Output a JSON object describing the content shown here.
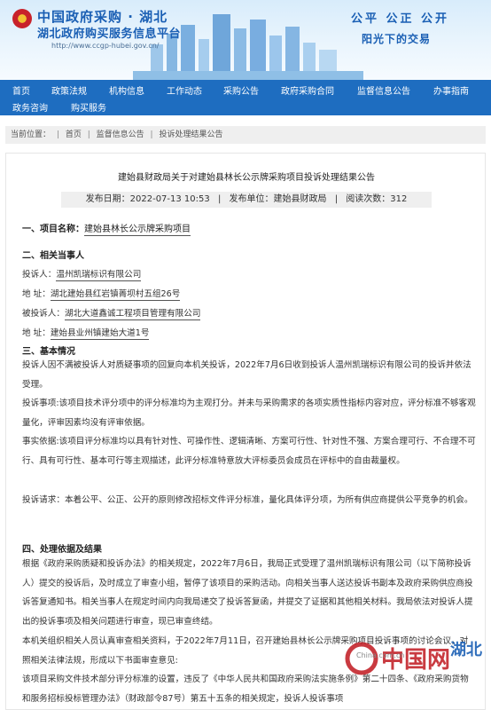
{
  "header": {
    "title": "中国政府采购 · 湖北",
    "subtitle": "湖北政府购买服务信息平台",
    "url": "http://www.ccgp-hubei.gov.cn/",
    "slogan_1": "公平  公正  公开",
    "slogan_2": "阳光下的交易"
  },
  "nav": {
    "items": [
      {
        "label": "首页"
      },
      {
        "label": "政策法规"
      },
      {
        "label": "机构信息"
      },
      {
        "label": "工作动态"
      },
      {
        "label": "采购公告"
      },
      {
        "label": "政府采购合同"
      },
      {
        "label": "监督信息公告"
      },
      {
        "label": "办事指南"
      },
      {
        "label": "政务咨询"
      },
      {
        "label": "购买服务"
      }
    ]
  },
  "breadcrumb": {
    "prefix": "当前位置：",
    "items": [
      "首页",
      "监督信息公告",
      "投诉处理结果公告"
    ]
  },
  "article": {
    "title": "建始县财政局关于对建始县林长公示牌采购项目投诉处理结果公告",
    "publish_date": "发布日期：2022-07-13 10:53",
    "publisher": "发布单位：建始县财政局",
    "views": "阅读次数：312",
    "s1_heading": "一、项目名称：",
    "s1_value": "建始县林长公示牌采购项目",
    "s2_heading": "二、相关当事人",
    "complainant_label": "投诉人：",
    "complainant": "温州凯瑞标识有限公司",
    "addr_label_1": "地  址：",
    "addr_1": "湖北建始县红岩镇菁坝村五组26号",
    "respondent_label": "被投诉人：",
    "respondent": "湖北大道鑫诚工程项目管理有限公司",
    "addr_label_2": "地  址：",
    "addr_2": "建始县业州镇建始大道1号",
    "s3_heading": "三、基本情况",
    "p1": "投诉人因不满被投诉人对质疑事项的回复向本机关投诉，2022年7月6日收到投诉人温州凯瑞标识有限公司的投诉并依法受理。",
    "p2": "投诉事项:该项目技术评分项中的评分标准均为主观打分。并未与采购需求的各项实质性指标内容对应，评分标准不够客观量化，评审因素均没有评审依据。",
    "p3": "事实依据:该项目评分标准均以具有针对性、可操作性、逻辑清晰、方案可行性、针对性不强、方案合理可行、不合理不可行、具有可行性、基本可行等主观描述，此评分标准特意放大评标委员会成员在评标中的自由裁量权。",
    "p4": "投诉请求：本着公平、公正、公开的原则修改招标文件评分标准，量化具体评分项，为所有供应商提供公平竞争的机会。",
    "s4_heading": "四、处理依据及结果",
    "p5": "根据《政府采购质疑和投诉办法》的相关规定，2022年7月6日，我局正式受理了温州凯瑞标识有限公司（以下简称投诉人）提交的投诉后，及时成立了审查小组，暂停了该项目的采购活动。向相关当事人送达投诉书副本及政府采购供应商投诉答复通知书。相关当事人在规定时间内向我局递交了投诉答复函，并提交了证据和其他相关材料。我局依法对投诉人提出的投诉事项及相关问题进行审查，现已审查终结。",
    "p6": "本机关组织相关人员认真审查相关资料，于2022年7月11日，召开建始县林长公示牌采购项目投诉事项的讨论会议，对照相关法律法规，形成以下书面审查意见:",
    "p7": "该项目采购文件技术部分评分标准的设置，违反了《中华人民共和国政府采购法实施条例》第二十四条、《政府采购货物和服务招标投标管理办法》（财政部令87号）第五十五条的相关规定，投诉人投诉事项"
  },
  "watermark": {
    "brand": "中国网",
    "region": "湖北",
    "domain": "China.com.cn"
  },
  "colors": {
    "nav_bg": "#1e6dc0",
    "brand_blue": "#1a5fb4",
    "watermark_red": "#c0181f"
  }
}
